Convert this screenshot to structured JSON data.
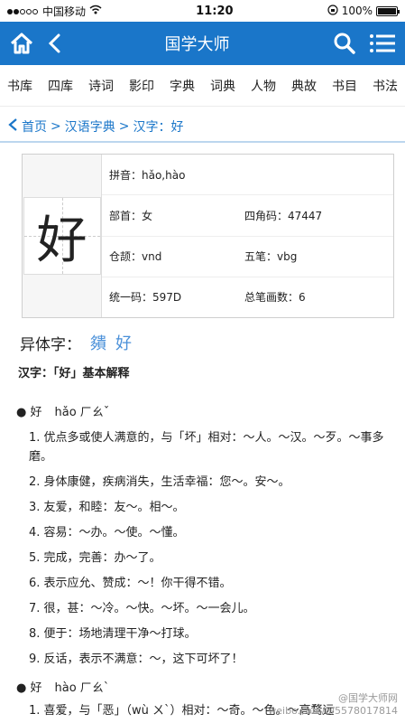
{
  "status": {
    "carrier": "中国移动",
    "time": "11:20",
    "battery": "100%",
    "battery_level": 1.0
  },
  "header": {
    "title": "国学大师"
  },
  "nav": {
    "items": [
      "书库",
      "四库",
      "诗词",
      "影印",
      "字典",
      "词典",
      "人物",
      "典故",
      "书目",
      "书法"
    ]
  },
  "breadcrumb": {
    "items": [
      "首页",
      "汉语字典",
      "汉字：好"
    ],
    "separator": ">"
  },
  "card": {
    "glyph": "好",
    "pinyin": "拼音：hǎo,hào",
    "radical": "部首：女",
    "sijiao": "四角码：47447",
    "cangjie": "仓颉：vnd",
    "wubi": "五笔：vbg",
    "unicode": "统一码：597D",
    "strokes": "总笔画数：6"
  },
  "variant": {
    "label": "异体字：",
    "chars": [
      "㚍",
      "好"
    ]
  },
  "subtitle": "汉字：「好」基本解释",
  "entry1": {
    "bullet": "● 好",
    "reading": "hǎo ㄏㄠˇ"
  },
  "defs1": [
    "1. 优点多或使人满意的，与「坏」相对：～人。～汉。～歹。～事多磨。",
    "2. 身体康健，疾病消失，生活幸福：您～。安～。",
    "3. 友爱，和睦：友～。相～。",
    "4. 容易：～办。～使。～懂。",
    "5. 完成，完善：办～了。",
    "6. 表示应允、赞成：～！你干得不错。",
    "7. 很，甚：～冷。～快。～坏。～一会儿。",
    "8. 便于：场地清理干净～打球。",
    "9. 反话，表示不满意：～，这下可坏了！"
  ],
  "entry2": {
    "bullet": "● 好",
    "reading": "hào ㄏㄠˋ"
  },
  "defs2": [
    "1. 喜爱，与「恶」（wù ㄨˋ）相对：～奇。～色。～高骛远"
  ],
  "watermark": {
    "line1": "@国学大师网",
    "line2": "weibo.com/u/5578017814"
  }
}
